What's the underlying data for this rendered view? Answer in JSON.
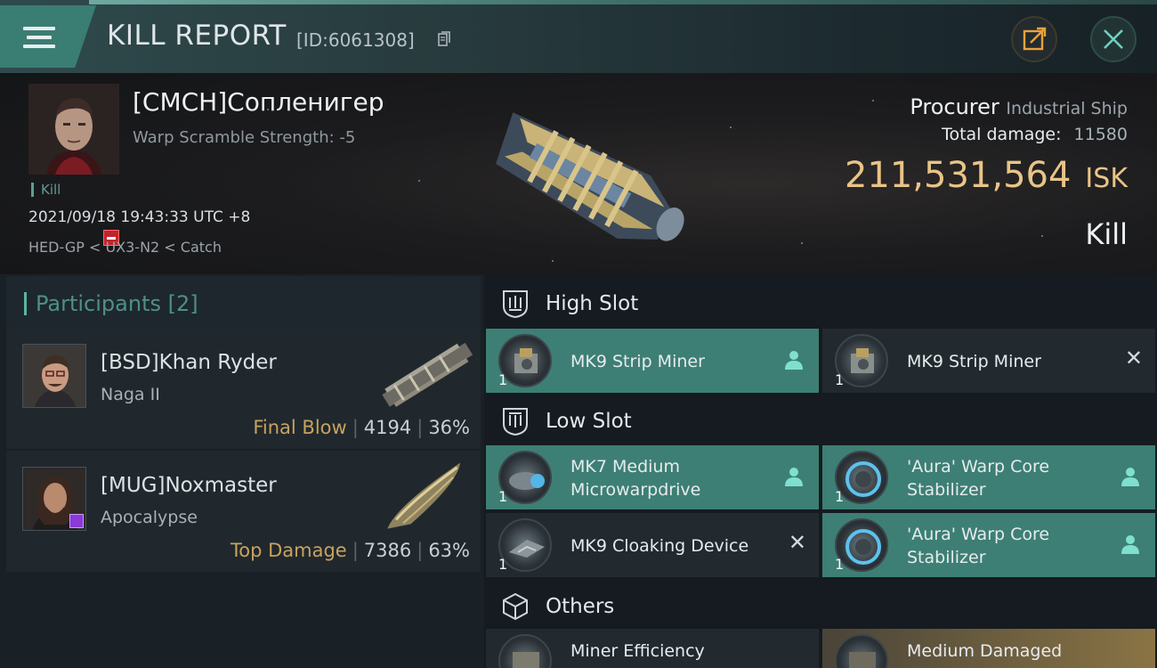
{
  "header": {
    "title": "KILL REPORT",
    "report_id": "[ID:6061308]"
  },
  "victim": {
    "name": "[CMCH]Сопленигер",
    "warp_scramble": "Warp Scramble Strength: -5",
    "report_type": "Kill",
    "datetime": "2021/09/18 19:43:33 UTC +8",
    "location": "HED-GP < UX3-N2 < Catch",
    "ship_name": "Procurer",
    "ship_class": "Industrial Ship",
    "total_damage_label": "Total damage:",
    "total_damage": "11580",
    "isk_value": "211,531,564",
    "isk_unit": "ISK",
    "outcome": "Kill"
  },
  "participants": {
    "title": "Participants",
    "count": "[2]",
    "list": [
      {
        "name": "[BSD]Khan Ryder",
        "ship": "Naga II",
        "tag": "Final Blow",
        "damage": "4194",
        "percent": "36%"
      },
      {
        "name": "[MUG]Noxmaster",
        "ship": "Apocalypse",
        "tag": "Top Damage",
        "damage": "7386",
        "percent": "63%"
      }
    ]
  },
  "sections": {
    "high": "High Slot",
    "low": "Low Slot",
    "others": "Others"
  },
  "items": {
    "high": [
      {
        "name": "MK9 Strip Miner",
        "qty": "1",
        "status": "fitted"
      },
      {
        "name": "MK9 Strip Miner",
        "qty": "1",
        "status": "destroyed"
      }
    ],
    "low": [
      {
        "name1": "MK7 Medium",
        "name2": "Microwarpdrive",
        "qty": "1",
        "status": "fitted"
      },
      {
        "name1": "'Aura' Warp Core",
        "name2": "Stabilizer",
        "qty": "1",
        "status": "fitted"
      },
      {
        "name1": "MK9 Cloaking Device",
        "qty": "1",
        "status": "destroyed"
      },
      {
        "name1": "'Aura' Warp Core",
        "name2": "Stabilizer",
        "qty": "1",
        "status": "fitted"
      }
    ],
    "others": [
      {
        "name": "Miner Efficiency"
      },
      {
        "name": "Medium Damaged"
      }
    ]
  },
  "colors": {
    "accent": "#3d7f74",
    "isk": "#e9c487",
    "tag": "#c9a25f"
  }
}
